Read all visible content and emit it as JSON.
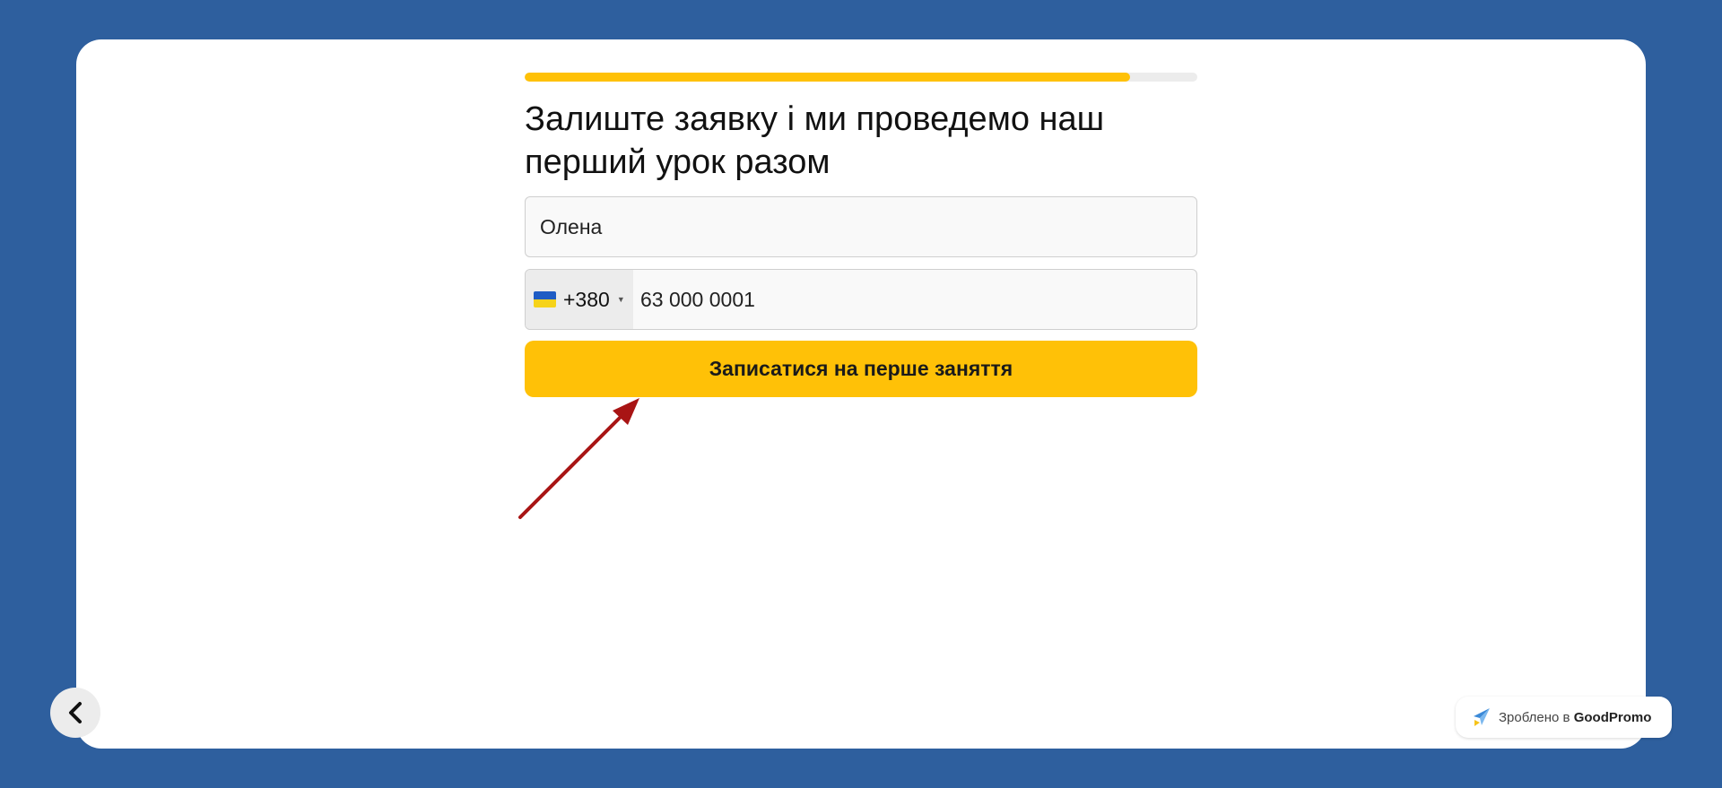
{
  "progress": {
    "percent": 90,
    "fill_color": "#ffc107"
  },
  "form": {
    "heading": "Залиште заявку і ми проведемо наш перший урок разом",
    "name_value": "Олена",
    "country_flag": "ukraine-flag-icon",
    "dial_code": "+380",
    "phone_value": "63 000 0001",
    "submit_label": "Записатися на перше заняття"
  },
  "navigation": {
    "back_icon": "chevron-left-icon"
  },
  "badge": {
    "prefix": "Зроблено в",
    "brand": "GoodPromo",
    "icon": "paper-plane-icon"
  },
  "colors": {
    "background": "#2e5f9e",
    "accent": "#ffc107",
    "annotation_arrow": "#a81414"
  }
}
